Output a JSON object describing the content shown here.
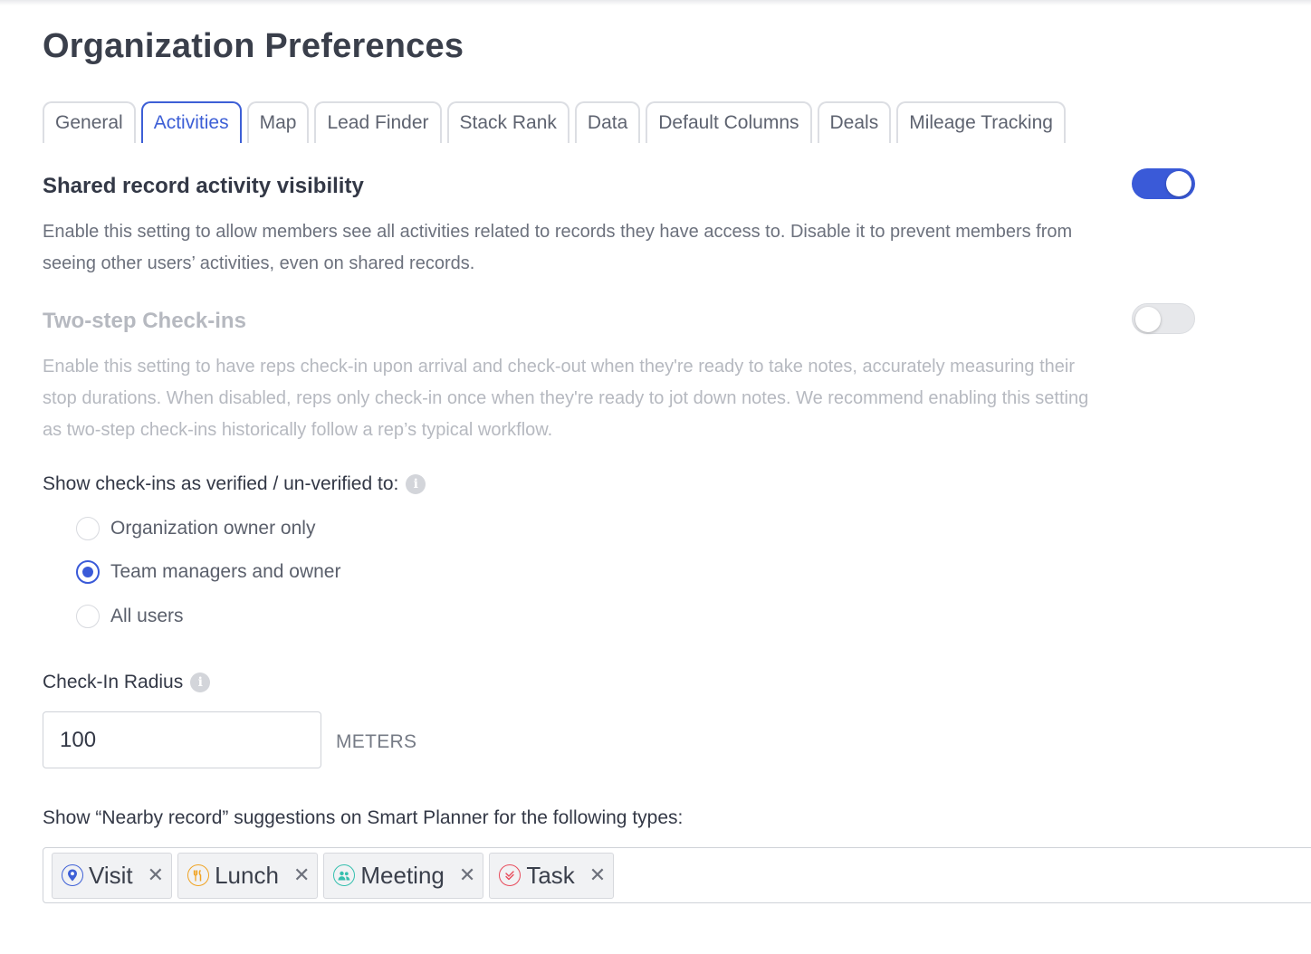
{
  "page": {
    "title": "Organization Preferences"
  },
  "tabs": [
    {
      "label": "General",
      "active": false
    },
    {
      "label": "Activities",
      "active": true
    },
    {
      "label": "Map",
      "active": false
    },
    {
      "label": "Lead Finder",
      "active": false
    },
    {
      "label": "Stack Rank",
      "active": false
    },
    {
      "label": "Data",
      "active": false
    },
    {
      "label": "Default Columns",
      "active": false
    },
    {
      "label": "Deals",
      "active": false
    },
    {
      "label": "Mileage Tracking",
      "active": false
    }
  ],
  "shared_visibility": {
    "title": "Shared record activity visibility",
    "description": "Enable this setting to allow members see all activities related to records they have access to. Disable it to prevent members from seeing other users’ activities, even on shared records.",
    "enabled": true
  },
  "two_step": {
    "title": "Two-step Check-ins",
    "description": "Enable this setting to have reps check-in upon arrival and check-out when they're ready to take notes, accurately measuring their stop durations. When disabled, reps only check-in once when they're ready to jot down notes. We recommend enabling this setting as two-step check-ins historically follow a rep’s typical workflow.",
    "enabled": false
  },
  "verified": {
    "label": "Show check-ins as verified / un-verified to:",
    "options": [
      {
        "label": "Organization owner only",
        "checked": false
      },
      {
        "label": "Team managers and owner",
        "checked": true
      },
      {
        "label": "All users",
        "checked": false
      }
    ]
  },
  "radius": {
    "label": "Check-In Radius",
    "value": "100",
    "unit": "METERS"
  },
  "nearby": {
    "label": "Show “Nearby record” suggestions on Smart Planner for the following types:",
    "tags": [
      {
        "label": "Visit",
        "icon": "location-pin-icon",
        "color": "#3d5fd6"
      },
      {
        "label": "Lunch",
        "icon": "fork-knife-icon",
        "color": "#f0a322"
      },
      {
        "label": "Meeting",
        "icon": "people-icon",
        "color": "#35bfae"
      },
      {
        "label": "Task",
        "icon": "check-double-icon",
        "color": "#e84a5a"
      }
    ]
  }
}
